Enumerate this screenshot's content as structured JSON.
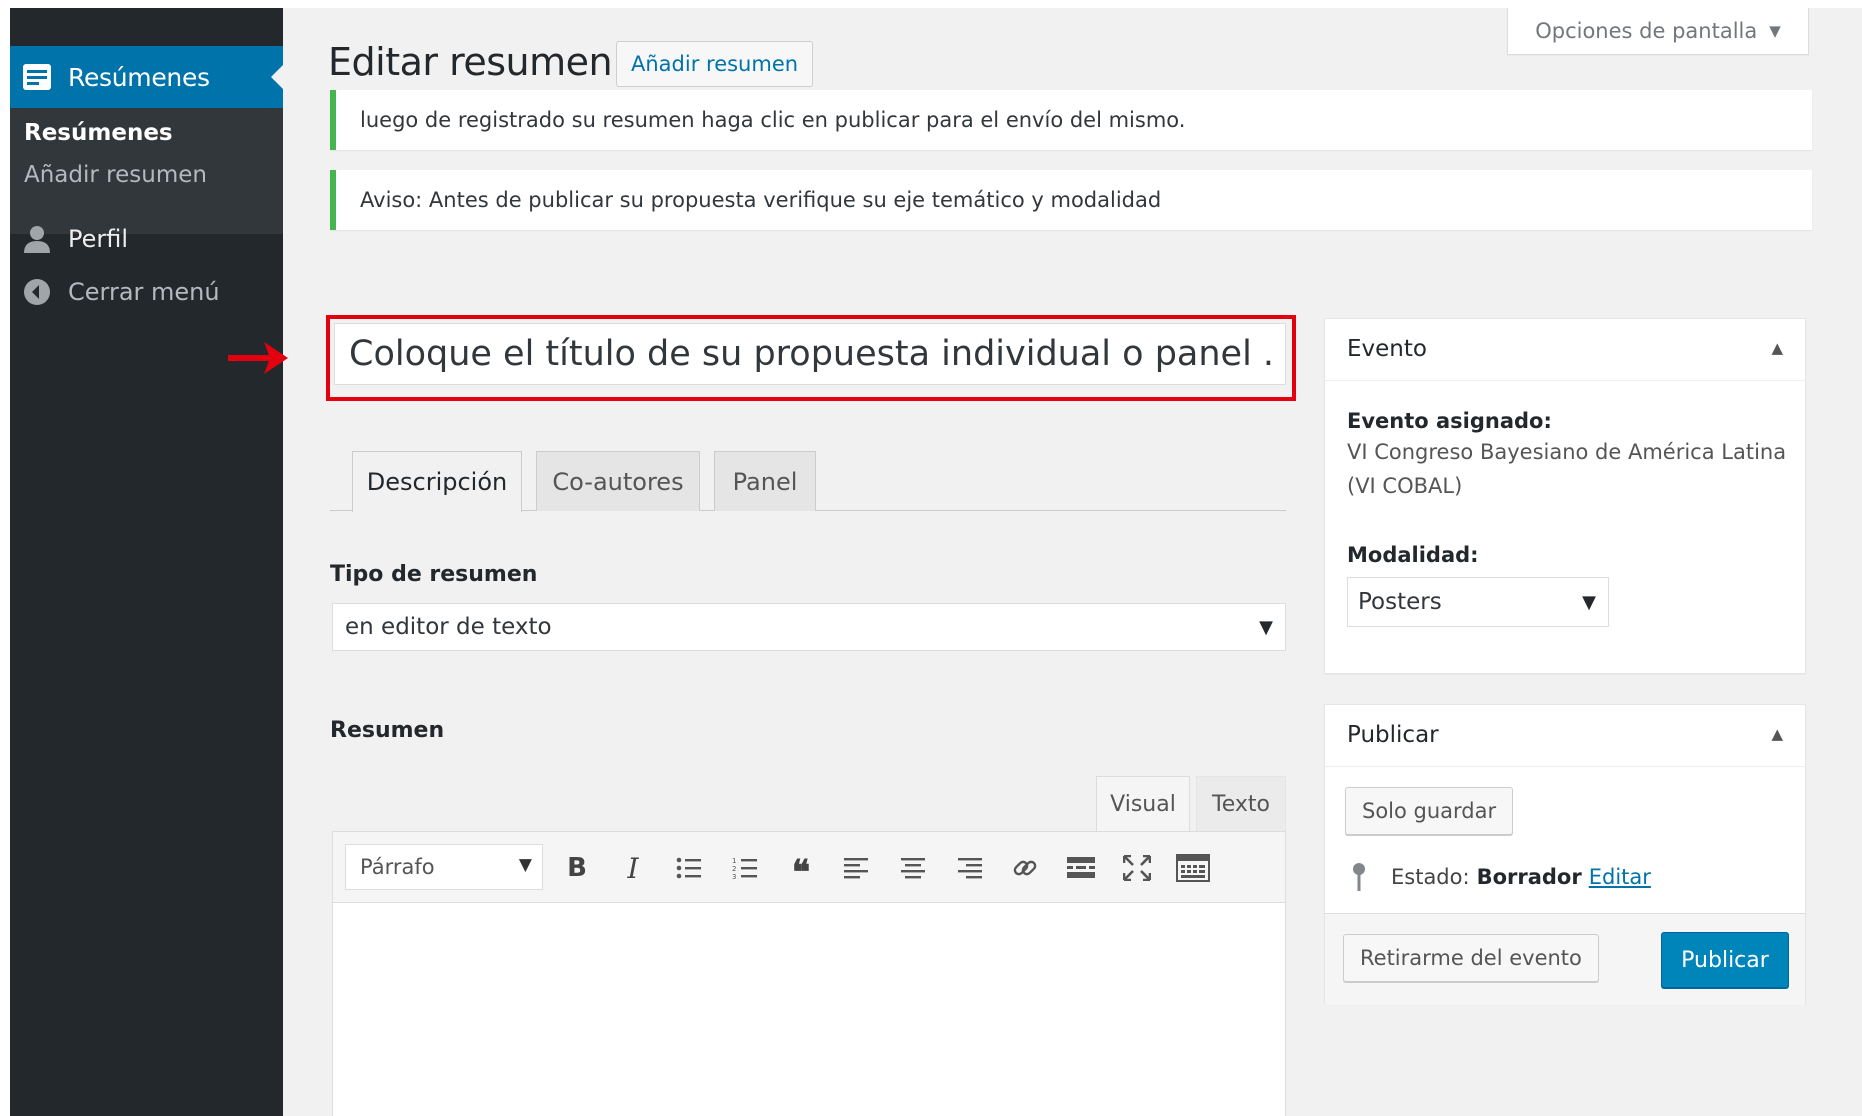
{
  "sidebar": {
    "active_item": "Resúmenes",
    "submenu": [
      "Resúmenes",
      "Añadir resumen"
    ],
    "profile": "Perfil",
    "collapse": "Cerrar menú"
  },
  "header": {
    "title": "Editar resumen",
    "add_button": "Añadir resumen",
    "screen_options": "Opciones de pantalla"
  },
  "notices": [
    "luego de registrado su resumen haga clic en publicar para el envío del mismo.",
    "Aviso: Antes de publicar su propuesta verifique su eje temático y modalidad"
  ],
  "title_input": {
    "value": "Coloque el título de su propuesta individual o panel ..."
  },
  "tabs": [
    "Descripción",
    "Co-autores",
    "Panel"
  ],
  "tipo": {
    "label": "Tipo de resumen",
    "selected": "en editor de texto"
  },
  "resumen": {
    "label": "Resumen",
    "mode_tabs": [
      "Visual",
      "Texto"
    ],
    "format_select": "Párrafo",
    "toolbar_icons": [
      "bold-icon",
      "italic-icon",
      "bullet-list-icon",
      "numbered-list-icon",
      "blockquote-icon",
      "align-left-icon",
      "align-center-icon",
      "align-right-icon",
      "link-icon",
      "read-more-icon",
      "fullscreen-icon",
      "toolbar-toggle-icon"
    ]
  },
  "evento_box": {
    "title": "Evento",
    "assigned_label": "Evento asignado:",
    "assigned_value": "VI Congreso Bayesiano de América Latina (VI COBAL)",
    "modalidad_label": "Modalidad:",
    "modalidad_value": "Posters"
  },
  "publicar_box": {
    "title": "Publicar",
    "save_button": "Solo guardar",
    "status_label": "Estado:",
    "status_value": "Borrador",
    "edit_link": "Editar",
    "withdraw_button": "Retirarme del evento",
    "publish_button": "Publicar"
  },
  "colors": {
    "sidebar_bg": "#23282d",
    "accent": "#0073aa",
    "notice_border": "#46b450",
    "highlight": "#e3000f"
  }
}
